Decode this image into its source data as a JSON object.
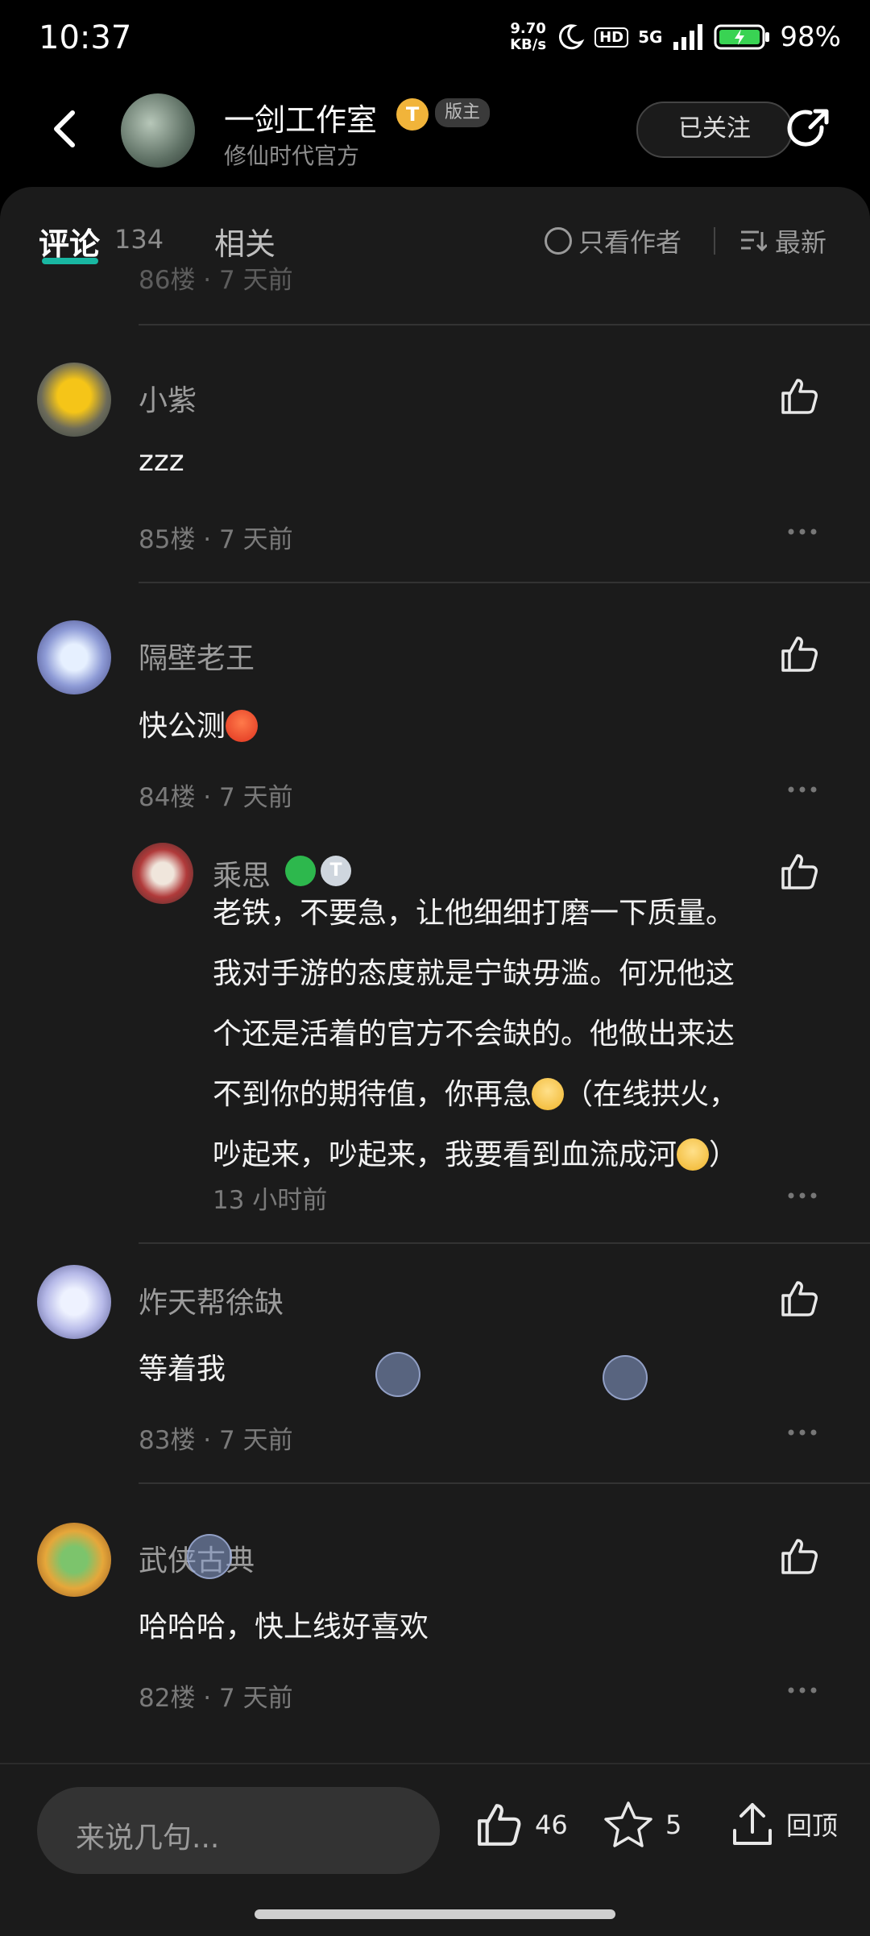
{
  "status_bar": {
    "time": "10:37",
    "net_speed": "9.70",
    "net_unit": "KB/s",
    "hd": "HD",
    "signal": "5G",
    "battery": "98%"
  },
  "header": {
    "name": "一剑工作室",
    "badge_t": "T",
    "badge_mod": "版主",
    "subtitle": "修仙时代官方",
    "follow_label": "已关注"
  },
  "tabs": {
    "comment": "评论",
    "comment_count": "134",
    "related": "相关",
    "only_author": "只看作者",
    "sort": "最新"
  },
  "partial_top": {
    "meta": "86楼 · 7 天前"
  },
  "comments": [
    {
      "name": "小紫",
      "text": "zzz",
      "meta": "85楼 · 7 天前"
    },
    {
      "name": "隔壁老王",
      "text": "快公测",
      "meta": "84楼 · 7 天前",
      "reply": {
        "name": "乘思",
        "badge_t": "T",
        "lines": [
          "老铁，不要急，让他细细打磨一下质量。",
          "我对手游的态度就是宁缺毋滥。何况他这",
          "个还是活着的官方不会缺的。他做出来达",
          "不到你的期待值，你再急",
          "（在线拱火，",
          "吵起来，吵起来，我要看到血流成河",
          "）"
        ],
        "meta": "13 小时前"
      }
    },
    {
      "name": "炸天帮徐缺",
      "text": "等着我",
      "meta": "83楼 · 7 天前"
    },
    {
      "name": "武侠古典",
      "text": "哈哈哈，快上线好喜欢",
      "meta": "82楼 · 7 天前"
    }
  ],
  "bottom_bar": {
    "input_placeholder": "来说几句...",
    "likes": "46",
    "favorites": "5",
    "top_label": "回顶"
  },
  "colors": {
    "accent": "#19b7a2",
    "bg": "#1b1b1b"
  }
}
